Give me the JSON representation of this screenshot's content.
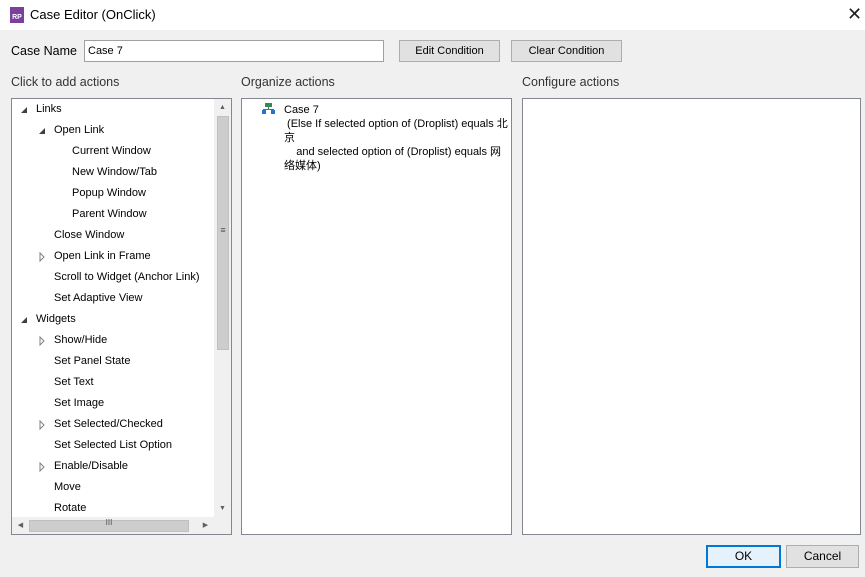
{
  "window": {
    "title": "Case Editor (OnClick)",
    "icon_label": "RP",
    "close_symbol": "✕"
  },
  "case_name": {
    "label": "Case Name",
    "value": "Case 7"
  },
  "buttons": {
    "edit_condition": "Edit Condition",
    "clear_condition": "Clear Condition",
    "ok": "OK",
    "cancel": "Cancel"
  },
  "sections": {
    "add_actions": "Click to add actions",
    "organize_actions": "Organize actions",
    "configure_actions": "Configure actions"
  },
  "tree": {
    "links": "Links",
    "open_link": "Open Link",
    "current_window": "Current Window",
    "new_window_tab": "New Window/Tab",
    "popup_window": "Popup Window",
    "parent_window": "Parent Window",
    "close_window": "Close Window",
    "open_link_in_frame": "Open Link in Frame",
    "scroll_to_widget": "Scroll to Widget (Anchor Link)",
    "set_adaptive_view": "Set Adaptive View",
    "widgets": "Widgets",
    "show_hide": "Show/Hide",
    "set_panel_state": "Set Panel State",
    "set_text": "Set Text",
    "set_image": "Set Image",
    "set_selected_checked": "Set Selected/Checked",
    "set_selected_list_option": "Set Selected List Option",
    "enable_disable": "Enable/Disable",
    "move": "Move",
    "rotate": "Rotate"
  },
  "organize": {
    "case_title": "Case 7",
    "condition_line1": " (Else If selected option of (Droplist) equals 北",
    "condition_line2": "京",
    "condition_line3": "    and selected option of (Droplist) equals 网",
    "condition_line4": "络媒体)"
  },
  "scrollbar": {
    "vgrip": "≡",
    "hgrip": "III"
  }
}
